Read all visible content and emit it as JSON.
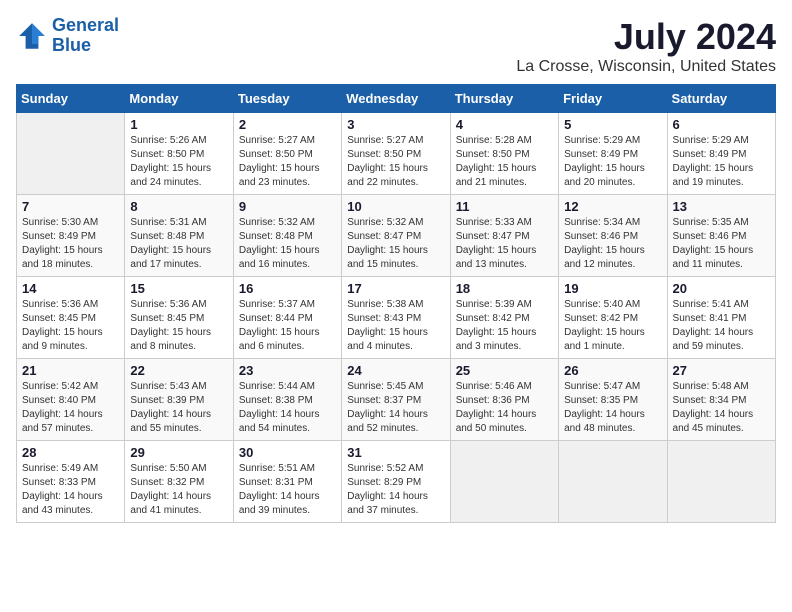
{
  "logo": {
    "line1": "General",
    "line2": "Blue"
  },
  "title": "July 2024",
  "subtitle": "La Crosse, Wisconsin, United States",
  "days_header": [
    "Sunday",
    "Monday",
    "Tuesday",
    "Wednesday",
    "Thursday",
    "Friday",
    "Saturday"
  ],
  "weeks": [
    [
      {
        "day": "",
        "info": ""
      },
      {
        "day": "1",
        "info": "Sunrise: 5:26 AM\nSunset: 8:50 PM\nDaylight: 15 hours\nand 24 minutes."
      },
      {
        "day": "2",
        "info": "Sunrise: 5:27 AM\nSunset: 8:50 PM\nDaylight: 15 hours\nand 23 minutes."
      },
      {
        "day": "3",
        "info": "Sunrise: 5:27 AM\nSunset: 8:50 PM\nDaylight: 15 hours\nand 22 minutes."
      },
      {
        "day": "4",
        "info": "Sunrise: 5:28 AM\nSunset: 8:50 PM\nDaylight: 15 hours\nand 21 minutes."
      },
      {
        "day": "5",
        "info": "Sunrise: 5:29 AM\nSunset: 8:49 PM\nDaylight: 15 hours\nand 20 minutes."
      },
      {
        "day": "6",
        "info": "Sunrise: 5:29 AM\nSunset: 8:49 PM\nDaylight: 15 hours\nand 19 minutes."
      }
    ],
    [
      {
        "day": "7",
        "info": "Sunrise: 5:30 AM\nSunset: 8:49 PM\nDaylight: 15 hours\nand 18 minutes."
      },
      {
        "day": "8",
        "info": "Sunrise: 5:31 AM\nSunset: 8:48 PM\nDaylight: 15 hours\nand 17 minutes."
      },
      {
        "day": "9",
        "info": "Sunrise: 5:32 AM\nSunset: 8:48 PM\nDaylight: 15 hours\nand 16 minutes."
      },
      {
        "day": "10",
        "info": "Sunrise: 5:32 AM\nSunset: 8:47 PM\nDaylight: 15 hours\nand 15 minutes."
      },
      {
        "day": "11",
        "info": "Sunrise: 5:33 AM\nSunset: 8:47 PM\nDaylight: 15 hours\nand 13 minutes."
      },
      {
        "day": "12",
        "info": "Sunrise: 5:34 AM\nSunset: 8:46 PM\nDaylight: 15 hours\nand 12 minutes."
      },
      {
        "day": "13",
        "info": "Sunrise: 5:35 AM\nSunset: 8:46 PM\nDaylight: 15 hours\nand 11 minutes."
      }
    ],
    [
      {
        "day": "14",
        "info": "Sunrise: 5:36 AM\nSunset: 8:45 PM\nDaylight: 15 hours\nand 9 minutes."
      },
      {
        "day": "15",
        "info": "Sunrise: 5:36 AM\nSunset: 8:45 PM\nDaylight: 15 hours\nand 8 minutes."
      },
      {
        "day": "16",
        "info": "Sunrise: 5:37 AM\nSunset: 8:44 PM\nDaylight: 15 hours\nand 6 minutes."
      },
      {
        "day": "17",
        "info": "Sunrise: 5:38 AM\nSunset: 8:43 PM\nDaylight: 15 hours\nand 4 minutes."
      },
      {
        "day": "18",
        "info": "Sunrise: 5:39 AM\nSunset: 8:42 PM\nDaylight: 15 hours\nand 3 minutes."
      },
      {
        "day": "19",
        "info": "Sunrise: 5:40 AM\nSunset: 8:42 PM\nDaylight: 15 hours\nand 1 minute."
      },
      {
        "day": "20",
        "info": "Sunrise: 5:41 AM\nSunset: 8:41 PM\nDaylight: 14 hours\nand 59 minutes."
      }
    ],
    [
      {
        "day": "21",
        "info": "Sunrise: 5:42 AM\nSunset: 8:40 PM\nDaylight: 14 hours\nand 57 minutes."
      },
      {
        "day": "22",
        "info": "Sunrise: 5:43 AM\nSunset: 8:39 PM\nDaylight: 14 hours\nand 55 minutes."
      },
      {
        "day": "23",
        "info": "Sunrise: 5:44 AM\nSunset: 8:38 PM\nDaylight: 14 hours\nand 54 minutes."
      },
      {
        "day": "24",
        "info": "Sunrise: 5:45 AM\nSunset: 8:37 PM\nDaylight: 14 hours\nand 52 minutes."
      },
      {
        "day": "25",
        "info": "Sunrise: 5:46 AM\nSunset: 8:36 PM\nDaylight: 14 hours\nand 50 minutes."
      },
      {
        "day": "26",
        "info": "Sunrise: 5:47 AM\nSunset: 8:35 PM\nDaylight: 14 hours\nand 48 minutes."
      },
      {
        "day": "27",
        "info": "Sunrise: 5:48 AM\nSunset: 8:34 PM\nDaylight: 14 hours\nand 45 minutes."
      }
    ],
    [
      {
        "day": "28",
        "info": "Sunrise: 5:49 AM\nSunset: 8:33 PM\nDaylight: 14 hours\nand 43 minutes."
      },
      {
        "day": "29",
        "info": "Sunrise: 5:50 AM\nSunset: 8:32 PM\nDaylight: 14 hours\nand 41 minutes."
      },
      {
        "day": "30",
        "info": "Sunrise: 5:51 AM\nSunset: 8:31 PM\nDaylight: 14 hours\nand 39 minutes."
      },
      {
        "day": "31",
        "info": "Sunrise: 5:52 AM\nSunset: 8:29 PM\nDaylight: 14 hours\nand 37 minutes."
      },
      {
        "day": "",
        "info": ""
      },
      {
        "day": "",
        "info": ""
      },
      {
        "day": "",
        "info": ""
      }
    ]
  ]
}
